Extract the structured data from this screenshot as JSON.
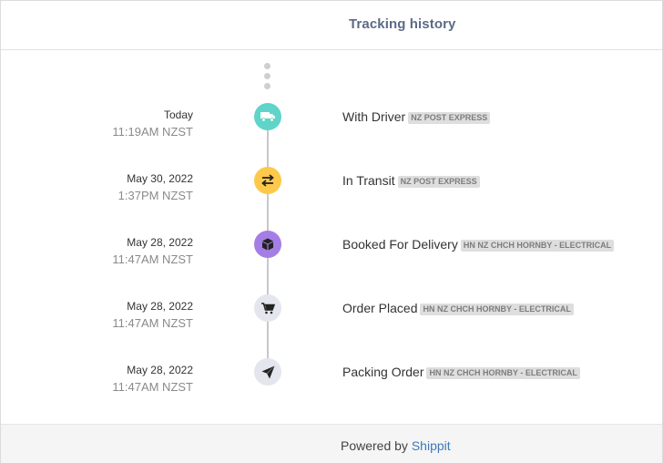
{
  "header": {
    "title": "Tracking history"
  },
  "events": [
    {
      "date": "Today",
      "time": "11:19AM NZST",
      "label": "With Driver",
      "badge": "NZ POST EXPRESS",
      "icon": "truck-icon",
      "icon_color": "#5fd4c8"
    },
    {
      "date": "May 30, 2022",
      "time": "1:37PM NZST",
      "label": "In Transit",
      "badge": "NZ POST EXPRESS",
      "icon": "exchange-arrows-icon",
      "icon_color": "#fdc94a"
    },
    {
      "date": "May 28, 2022",
      "time": "11:47AM NZST",
      "label": "Booked For Delivery",
      "badge": "HN NZ CHCH HORNBY - ELECTRICAL",
      "icon": "package-icon",
      "icon_color": "#a57ee5"
    },
    {
      "date": "May 28, 2022",
      "time": "11:47AM NZST",
      "label": "Order Placed",
      "badge": "HN NZ CHCH HORNBY - ELECTRICAL",
      "icon": "cart-icon",
      "icon_color": "#e4e6ee"
    },
    {
      "date": "May 28, 2022",
      "time": "11:47AM NZST",
      "label": "Packing Order",
      "badge": "HN NZ CHCH HORNBY - ELECTRICAL",
      "icon": "paper-plane-icon",
      "icon_color": "#e4e6ee"
    }
  ],
  "footer": {
    "prefix": "Powered by",
    "link": "Shippit"
  }
}
